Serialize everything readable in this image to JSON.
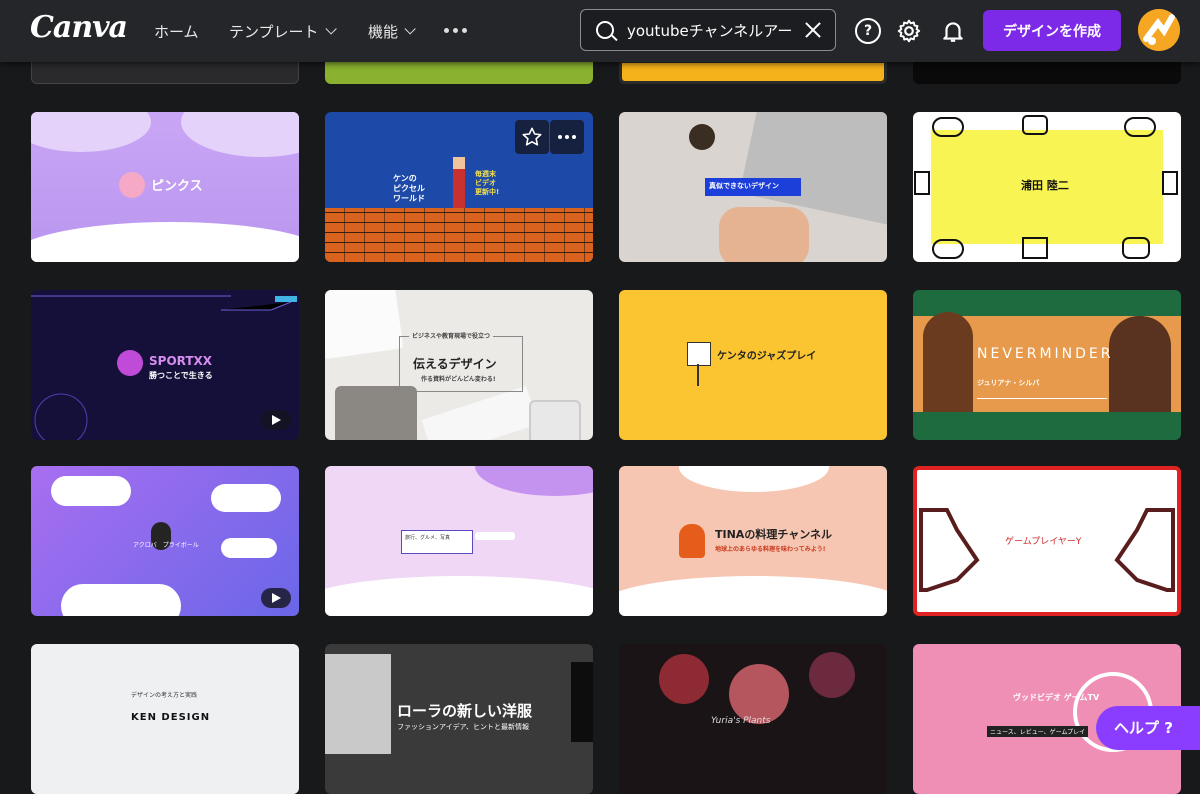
{
  "header": {
    "logo": "Canva",
    "nav": [
      {
        "label": "ホーム"
      },
      {
        "label": "テンプレート"
      },
      {
        "label": "機能"
      }
    ],
    "search_value": "youtubeチャンネルアー",
    "create_button": "デザインを作成",
    "icons": [
      "help-circle-icon",
      "gear-icon",
      "bell-icon"
    ]
  },
  "cards": [
    {
      "caption": "ピンクス"
    },
    {
      "caption_lines": [
        "ケンの",
        "ピクセル",
        "ワールド"
      ],
      "side_text": [
        "毎週末",
        "ビデオ",
        "更新中!"
      ]
    },
    {
      "caption": "真似できないデザイン"
    },
    {
      "caption": "浦田 陸二"
    },
    {
      "caption": "SPORTXX",
      "subcaption": "勝つことで生きる"
    },
    {
      "caption_top": "ビジネスや教育現場で役立つ",
      "caption": "伝えるデザイン",
      "subcaption": "作る資料がどんどん変わる!"
    },
    {
      "caption": "ケンタのジャズプレイ"
    },
    {
      "caption": "NEVERMINDER",
      "subcaption": "ジュリアナ・シルバ"
    },
    {
      "caption": "アクロバ　プライボール"
    },
    {
      "caption": "旅行、グルメ、写真"
    },
    {
      "caption": "TINAの料理チャンネル",
      "subcaption": "地球上のあらゆる料理を味わってみよう!"
    },
    {
      "caption": "ゲームプレイヤーY"
    },
    {
      "caption_top": "デザインの考え方と実践",
      "caption": "KEN DESIGN"
    },
    {
      "caption": "ローラの新しい洋服",
      "subcaption": "ファッションアイデア、ヒントと最新情報"
    },
    {
      "caption": "Yuria's Plants"
    },
    {
      "caption": "ヴッドビデオ ゲームTV",
      "subcaption": "ニュース、レビュー、ゲームプレイ"
    }
  ],
  "help_button": "ヘルプ ?",
  "colors": {
    "topbar": "#25262a",
    "background": "#18191b",
    "accent_purple": "#7d2ae8"
  }
}
